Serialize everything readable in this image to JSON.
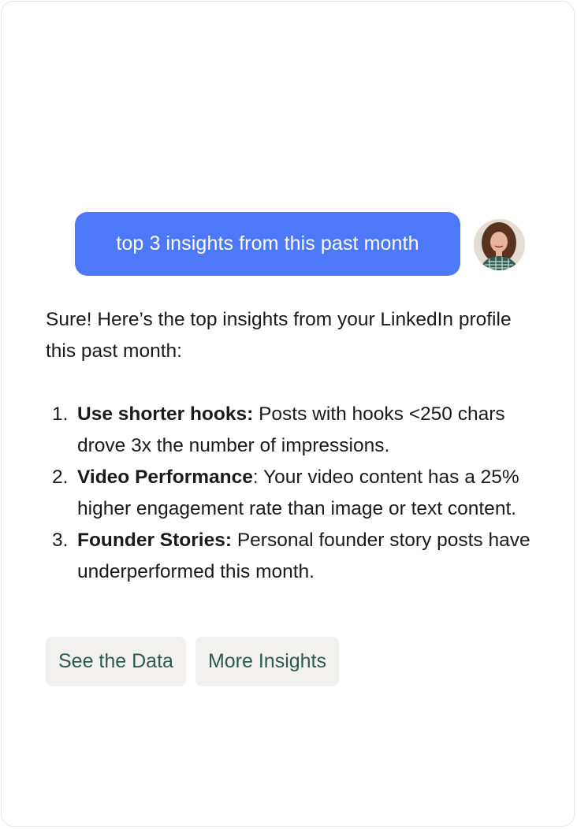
{
  "user_message": {
    "text": "top 3 insights from this past month"
  },
  "assistant_message": {
    "intro": "Sure! Here’s the top insights from your LinkedIn profile this past month:",
    "insights": [
      {
        "number": "1.",
        "title": "Use shorter hooks:",
        "text": " Posts with hooks <250 chars drove 3x the number of impressions."
      },
      {
        "number": "2.",
        "title": "Video Performance",
        "text": ": Your video content has a 25% higher engagement rate than image or text content."
      },
      {
        "number": "3.",
        "title": "Founder Stories:",
        "text": " Personal founder story posts have underperformed this month."
      }
    ]
  },
  "actions": {
    "see_data_label": "See the Data",
    "more_insights_label": "More Insights"
  },
  "colors": {
    "user_bubble": "#4d78f7",
    "button_bg": "#f3f1ef",
    "button_text": "#2c5a4e"
  },
  "icons": {
    "avatar": "user-avatar-photo"
  }
}
